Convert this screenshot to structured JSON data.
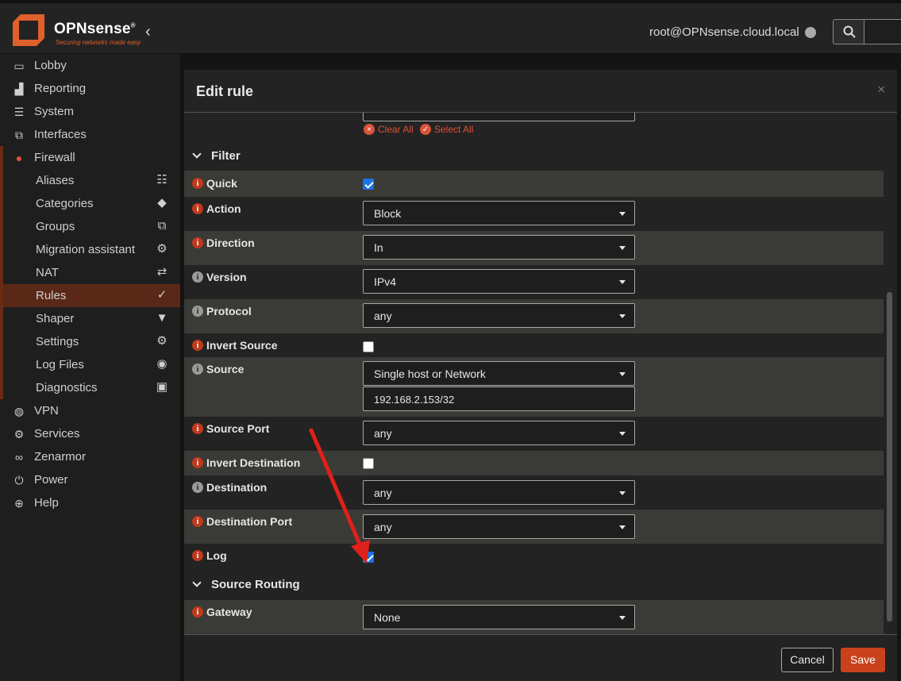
{
  "header": {
    "brand": "OPNsense",
    "brand_mark": "®",
    "tagline": "Securing networks made easy",
    "collapse_icon": "chevron-left-icon",
    "user": "root@OPNsense.cloud.local",
    "search_icon": "search-icon"
  },
  "sidebar": {
    "items": [
      {
        "label": "Lobby",
        "icon": "laptop-icon"
      },
      {
        "label": "Reporting",
        "icon": "chart-icon"
      },
      {
        "label": "System",
        "icon": "server-icon"
      },
      {
        "label": "Interfaces",
        "icon": "sitemap-icon"
      },
      {
        "label": "Firewall",
        "icon": "fire-icon"
      }
    ],
    "firewall_sub": [
      {
        "label": "Aliases",
        "icon": "list-icon"
      },
      {
        "label": "Categories",
        "icon": "tags-icon"
      },
      {
        "label": "Groups",
        "icon": "sitemap-icon"
      },
      {
        "label": "Migration assistant",
        "icon": "cogs-icon"
      },
      {
        "label": "NAT",
        "icon": "exchange-icon"
      },
      {
        "label": "Rules",
        "icon": "check-icon"
      },
      {
        "label": "Shaper",
        "icon": "filter-icon"
      },
      {
        "label": "Settings",
        "icon": "cogs-icon"
      },
      {
        "label": "Log Files",
        "icon": "eye-icon"
      },
      {
        "label": "Diagnostics",
        "icon": "medkit-icon"
      }
    ],
    "bottom_items": [
      {
        "label": "VPN",
        "icon": "globe-icon"
      },
      {
        "label": "Services",
        "icon": "cog-icon"
      },
      {
        "label": "Zenarmor",
        "icon": "binoculars-icon"
      },
      {
        "label": "Power",
        "icon": "plug-icon"
      },
      {
        "label": "Help",
        "icon": "lifebuoy-icon"
      }
    ],
    "active": "Rules"
  },
  "modal": {
    "title": "Edit rule",
    "close": "×",
    "clear_all": "Clear All",
    "select_all": "Select All",
    "filter_section": "Filter",
    "source_routing_section": "Source Routing",
    "fields": {
      "quick": {
        "label": "Quick",
        "checked": true
      },
      "action": {
        "label": "Action",
        "value": "Block"
      },
      "direction": {
        "label": "Direction",
        "value": "In"
      },
      "version": {
        "label": "Version",
        "value": "IPv4"
      },
      "protocol": {
        "label": "Protocol",
        "value": "any"
      },
      "invert_source": {
        "label": "Invert Source",
        "checked": false
      },
      "source": {
        "label": "Source",
        "value": "Single host or Network",
        "address": "192.168.2.153/32"
      },
      "source_port": {
        "label": "Source Port",
        "value": "any"
      },
      "invert_destination": {
        "label": "Invert Destination",
        "checked": false
      },
      "destination": {
        "label": "Destination",
        "value": "any"
      },
      "destination_port": {
        "label": "Destination Port",
        "value": "any"
      },
      "log": {
        "label": "Log",
        "checked": true
      },
      "gateway": {
        "label": "Gateway",
        "value": "None"
      }
    },
    "cancel": "Cancel",
    "save": "Save"
  },
  "colors": {
    "accent": "#c9421c",
    "annotation_arrow": "#e0201a",
    "checkbox_checked": "#1a73e8"
  }
}
